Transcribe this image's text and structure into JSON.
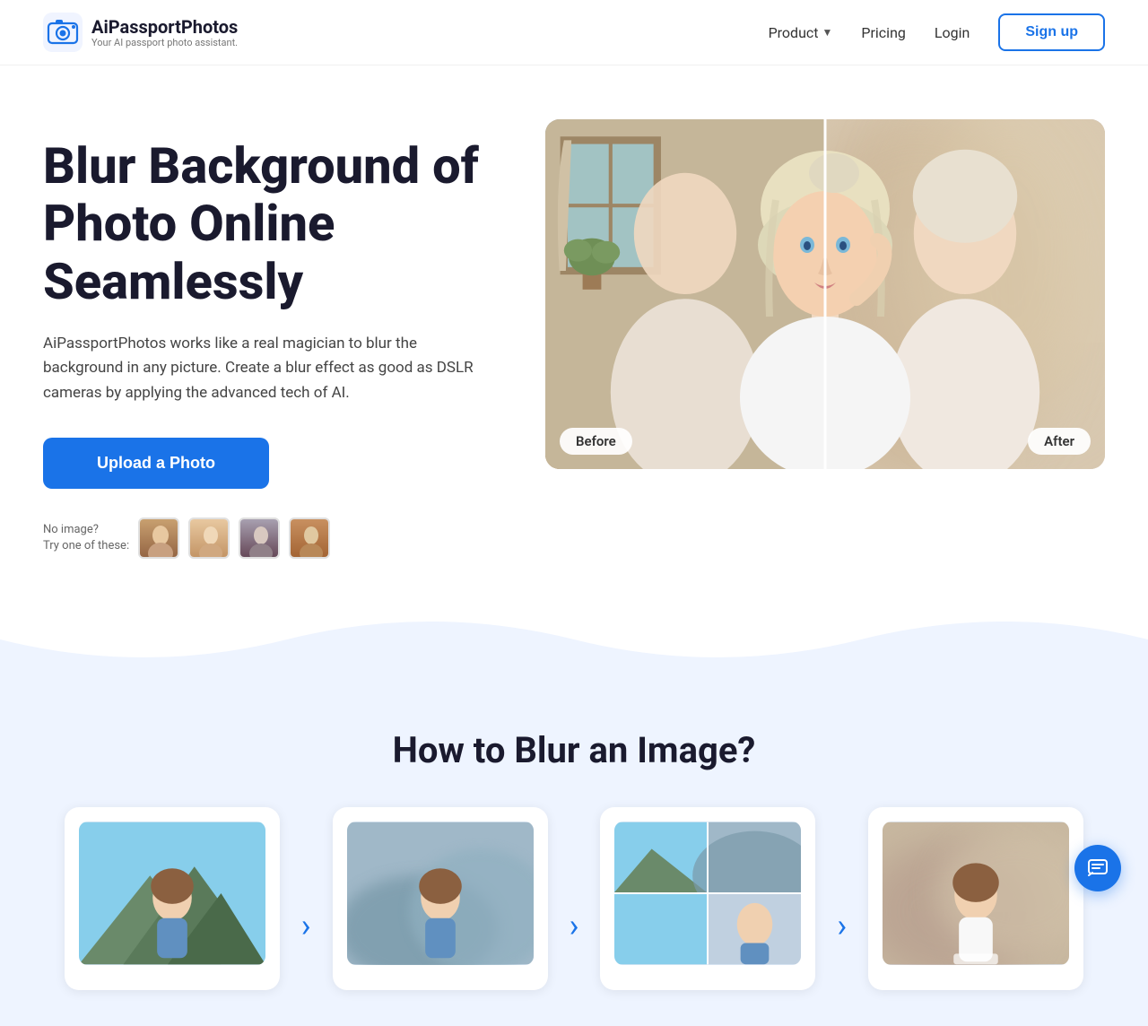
{
  "brand": {
    "name": "AiPassportPhotos",
    "tagline": "Your AI passport photo assistant.",
    "logo_alt": "AiPassportPhotos Logo"
  },
  "nav": {
    "product_label": "Product",
    "pricing_label": "Pricing",
    "login_label": "Login",
    "signup_label": "Sign up"
  },
  "hero": {
    "heading": "Blur Background of Photo Online Seamlessly",
    "description": "AiPassportPhotos works like a real magician to blur the background in any picture. Create a blur effect as good as DSLR cameras by applying the advanced tech of AI.",
    "upload_button": "Upload a Photo",
    "no_image_label": "No image?",
    "try_label": "Try one of these:",
    "before_label": "Before",
    "after_label": "After"
  },
  "how_to": {
    "heading": "How to Blur an Image?",
    "steps": [
      {
        "id": 1,
        "type": "person"
      },
      {
        "id": 2,
        "type": "mountain"
      },
      {
        "id": 3,
        "type": "composite"
      },
      {
        "id": 4,
        "type": "blurred"
      }
    ]
  },
  "sample_thumbs": [
    {
      "id": 1,
      "color_top": "#c8a070",
      "color_bottom": "#906040"
    },
    {
      "id": 2,
      "color_top": "#e8c8a0",
      "color_bottom": "#c09060"
    },
    {
      "id": 3,
      "color_top": "#908090",
      "color_bottom": "#604050"
    },
    {
      "id": 4,
      "color_top": "#c89060",
      "color_bottom": "#a06030"
    }
  ],
  "colors": {
    "primary": "#1a73e8",
    "bg_light": "#eef4ff",
    "text_dark": "#1a1a2e"
  }
}
